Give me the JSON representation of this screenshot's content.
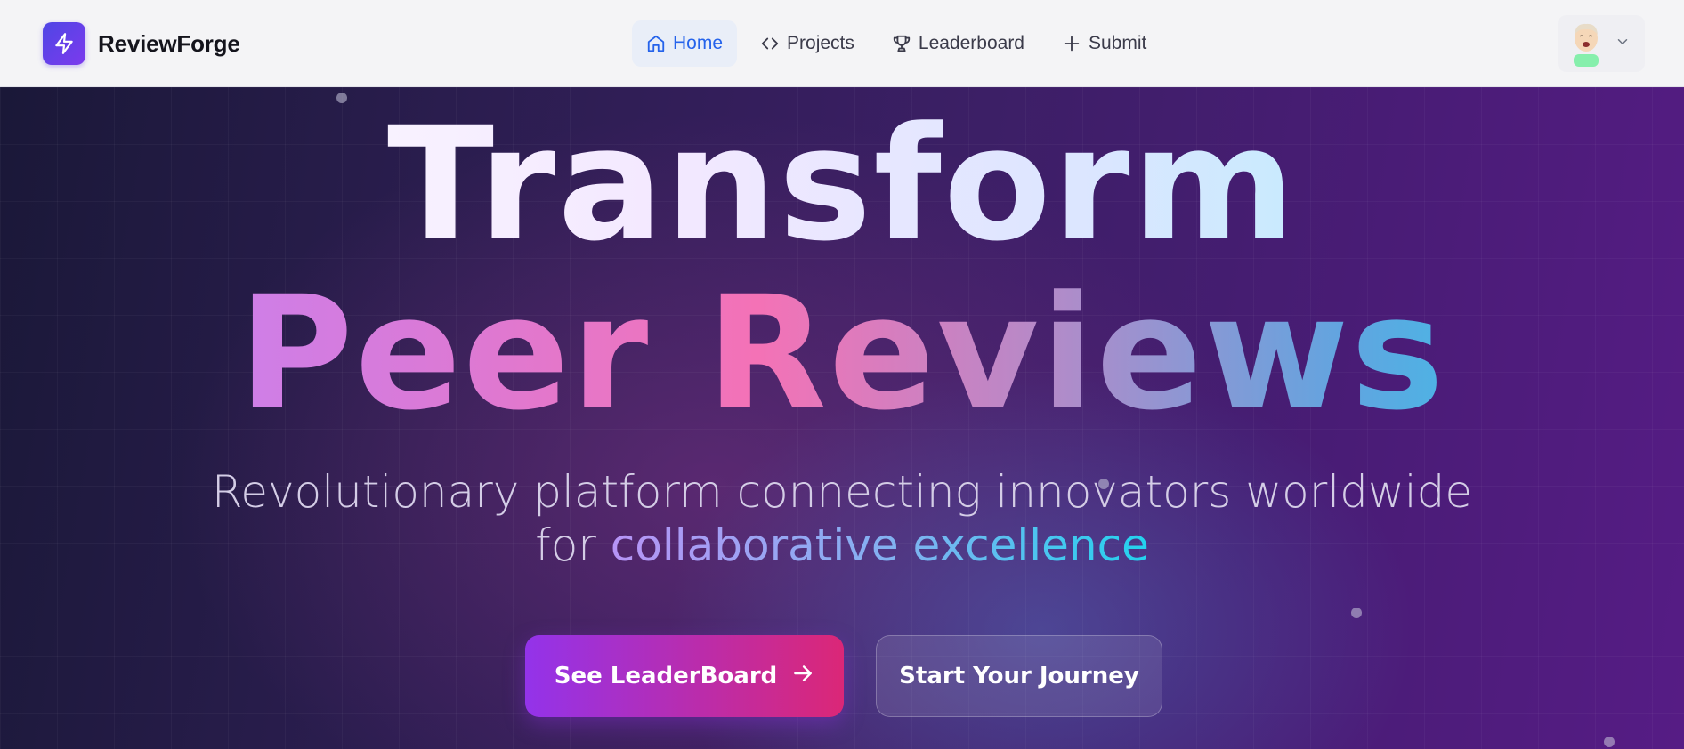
{
  "brand": {
    "name": "ReviewForge",
    "logo_icon": "lightning-bolt-icon"
  },
  "nav": {
    "items": [
      {
        "label": "Home",
        "icon": "home-icon",
        "active": true
      },
      {
        "label": "Projects",
        "icon": "code-icon",
        "active": false
      },
      {
        "label": "Leaderboard",
        "icon": "trophy-icon",
        "active": false
      },
      {
        "label": "Submit",
        "icon": "plus-icon",
        "active": false
      }
    ]
  },
  "user_menu": {
    "avatar": "avatar",
    "chevron": "chevron-down-icon"
  },
  "hero": {
    "headline_line1": "Transform",
    "headline_line2": "Peer Reviews",
    "subtitle_line1": "Revolutionary platform connecting innovators worldwide",
    "subtitle_prefix": "for ",
    "subtitle_highlight": "collaborative excellence",
    "primary_button": "See LeaderBoard",
    "secondary_button": "Start Your Journey"
  },
  "colors": {
    "active_nav": "#2563eb",
    "brand_gradient_start": "#4f46e5",
    "brand_gradient_end": "#7c3aed",
    "primary_button_start": "#9333ea",
    "primary_button_end": "#db2777"
  }
}
